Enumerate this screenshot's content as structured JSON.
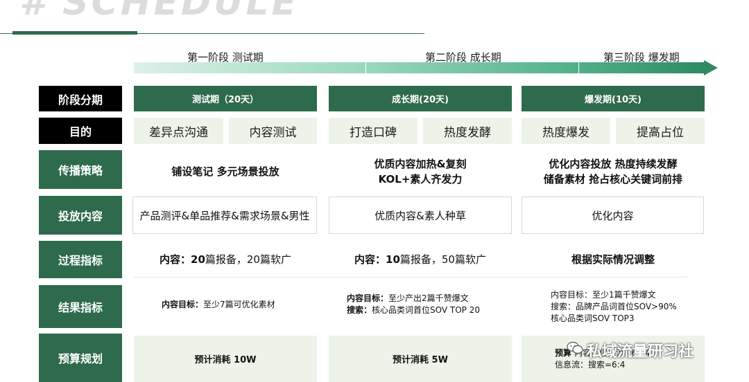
{
  "header": {
    "big_title": "# SCHEDULE",
    "phases": [
      "第一阶段 测试期",
      "第二阶段 成长期",
      "第三阶段 爆发期"
    ]
  },
  "rows": {
    "stage": "阶段分期",
    "purpose": "目的",
    "strategy": "传播策略",
    "content": "投放内容",
    "process": "过程指标",
    "result": "结果指标",
    "budget": "预算规划"
  },
  "columns": [
    {
      "stage": "测试期（20天）",
      "purpose": [
        "差异点沟通",
        "内容测试"
      ],
      "strategy": [
        "铺设笔记 多元场景投放"
      ],
      "content": "产品测评&单品推荐&需求场景&男性",
      "process_bold": "内容：20",
      "process_rest": "篇报备，20篇软广",
      "result": [
        {
          "bold": "内容目标：",
          "text": "至少7篇可优化素材"
        }
      ],
      "budget": "预计消耗 10W"
    },
    {
      "stage": "成长期(20天)",
      "purpose": [
        "打造口碑",
        "热度发酵"
      ],
      "strategy": [
        "优质内容加热&复刻",
        "KOL+素人齐发力"
      ],
      "content": "优质内容&素人种草",
      "process_bold": "内容：10",
      "process_rest": "篇报备，50篇软广",
      "result": [
        {
          "bold": "内容目标：",
          "text": "至少产出2篇千赞爆文"
        },
        {
          "bold": "搜索：",
          "text": "核心品类词首位SOV TOP 20"
        }
      ],
      "budget": "预计消耗 5W"
    },
    {
      "stage": "爆发期(10天)",
      "purpose": [
        "热度爆发",
        "提高占位"
      ],
      "strategy": [
        "优化内容投放 热度持续发酵",
        "储备素材 抢占核心关键词前排"
      ],
      "content": "优化内容",
      "process_bold": "根据实际情况调整",
      "process_rest": "",
      "result": [
        {
          "bold": "",
          "text": "内容目标：至少1篇千赞爆文"
        },
        {
          "bold": "",
          "text": "搜索：品牌产品词首位SOV>90%"
        },
        {
          "bold": "",
          "text": "核心品类词SOV TOP3"
        }
      ],
      "budget_line1": "预算",
      "budget_line1_rest": "内容：信息流=6：4",
      "budget_line2": "信息流：搜索=6:4"
    }
  ],
  "watermark": "私域流量研习社",
  "colors": {
    "accent": "#2e6b4c",
    "light": "#eef3e9",
    "black": "#000000"
  }
}
